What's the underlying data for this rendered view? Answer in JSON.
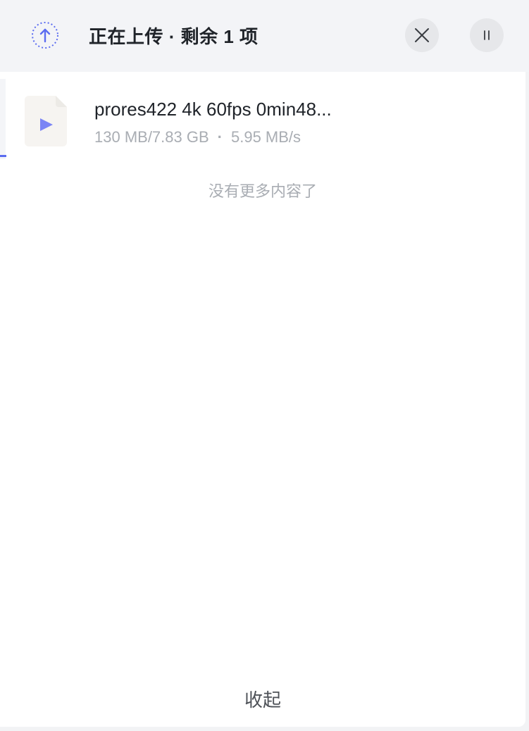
{
  "header": {
    "title": "正在上传 · 剩余 1 项",
    "upload_icon": "upload-arrow-icon",
    "close_icon": "close-icon",
    "pause_icon": "pause-icon"
  },
  "upload_items": [
    {
      "file_name": "prores422 4k 60fps 0min48...",
      "uploaded": "130 MB/7.83 GB",
      "separator": "·",
      "speed": "5.95 MB/s",
      "thumb_icon": "video-file-icon"
    }
  ],
  "end_note": "没有更多内容了",
  "footer": {
    "collapse_label": "收起"
  },
  "colors": {
    "accent": "#5b6cf0",
    "header_bg": "#f3f4f7",
    "text_primary": "#1f2329",
    "text_secondary": "#a9adb3"
  }
}
